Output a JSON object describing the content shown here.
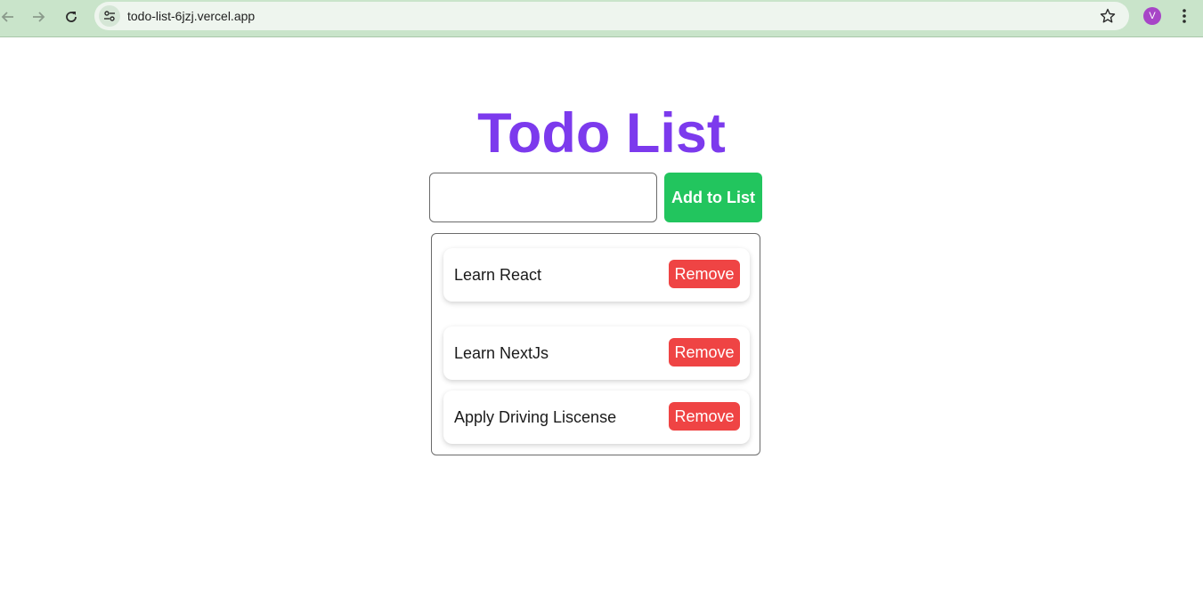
{
  "browser": {
    "url": "todo-list-6jzj.vercel.app",
    "profile_initial": "V",
    "icons": {
      "back": "back-arrow-icon",
      "forward": "forward-arrow-icon",
      "reload": "reload-icon",
      "site_info": "site-info-icon",
      "bookmark": "star-icon",
      "menu": "kebab-menu-icon"
    }
  },
  "app": {
    "title": "Todo List",
    "input": {
      "value": "",
      "placeholder": ""
    },
    "add_button_label": "Add to List",
    "items": [
      {
        "text": "Learn React",
        "remove_label": "Remove"
      },
      {
        "text": "Learn NextJs",
        "remove_label": "Remove"
      },
      {
        "text": "Apply Driving Liscense",
        "remove_label": "Remove"
      }
    ]
  },
  "colors": {
    "title": "#7c3aed",
    "add_button": "#22c55e",
    "remove_button": "#ef4444",
    "browser_bar": "#c9e4ca",
    "avatar": "#a745c7"
  }
}
